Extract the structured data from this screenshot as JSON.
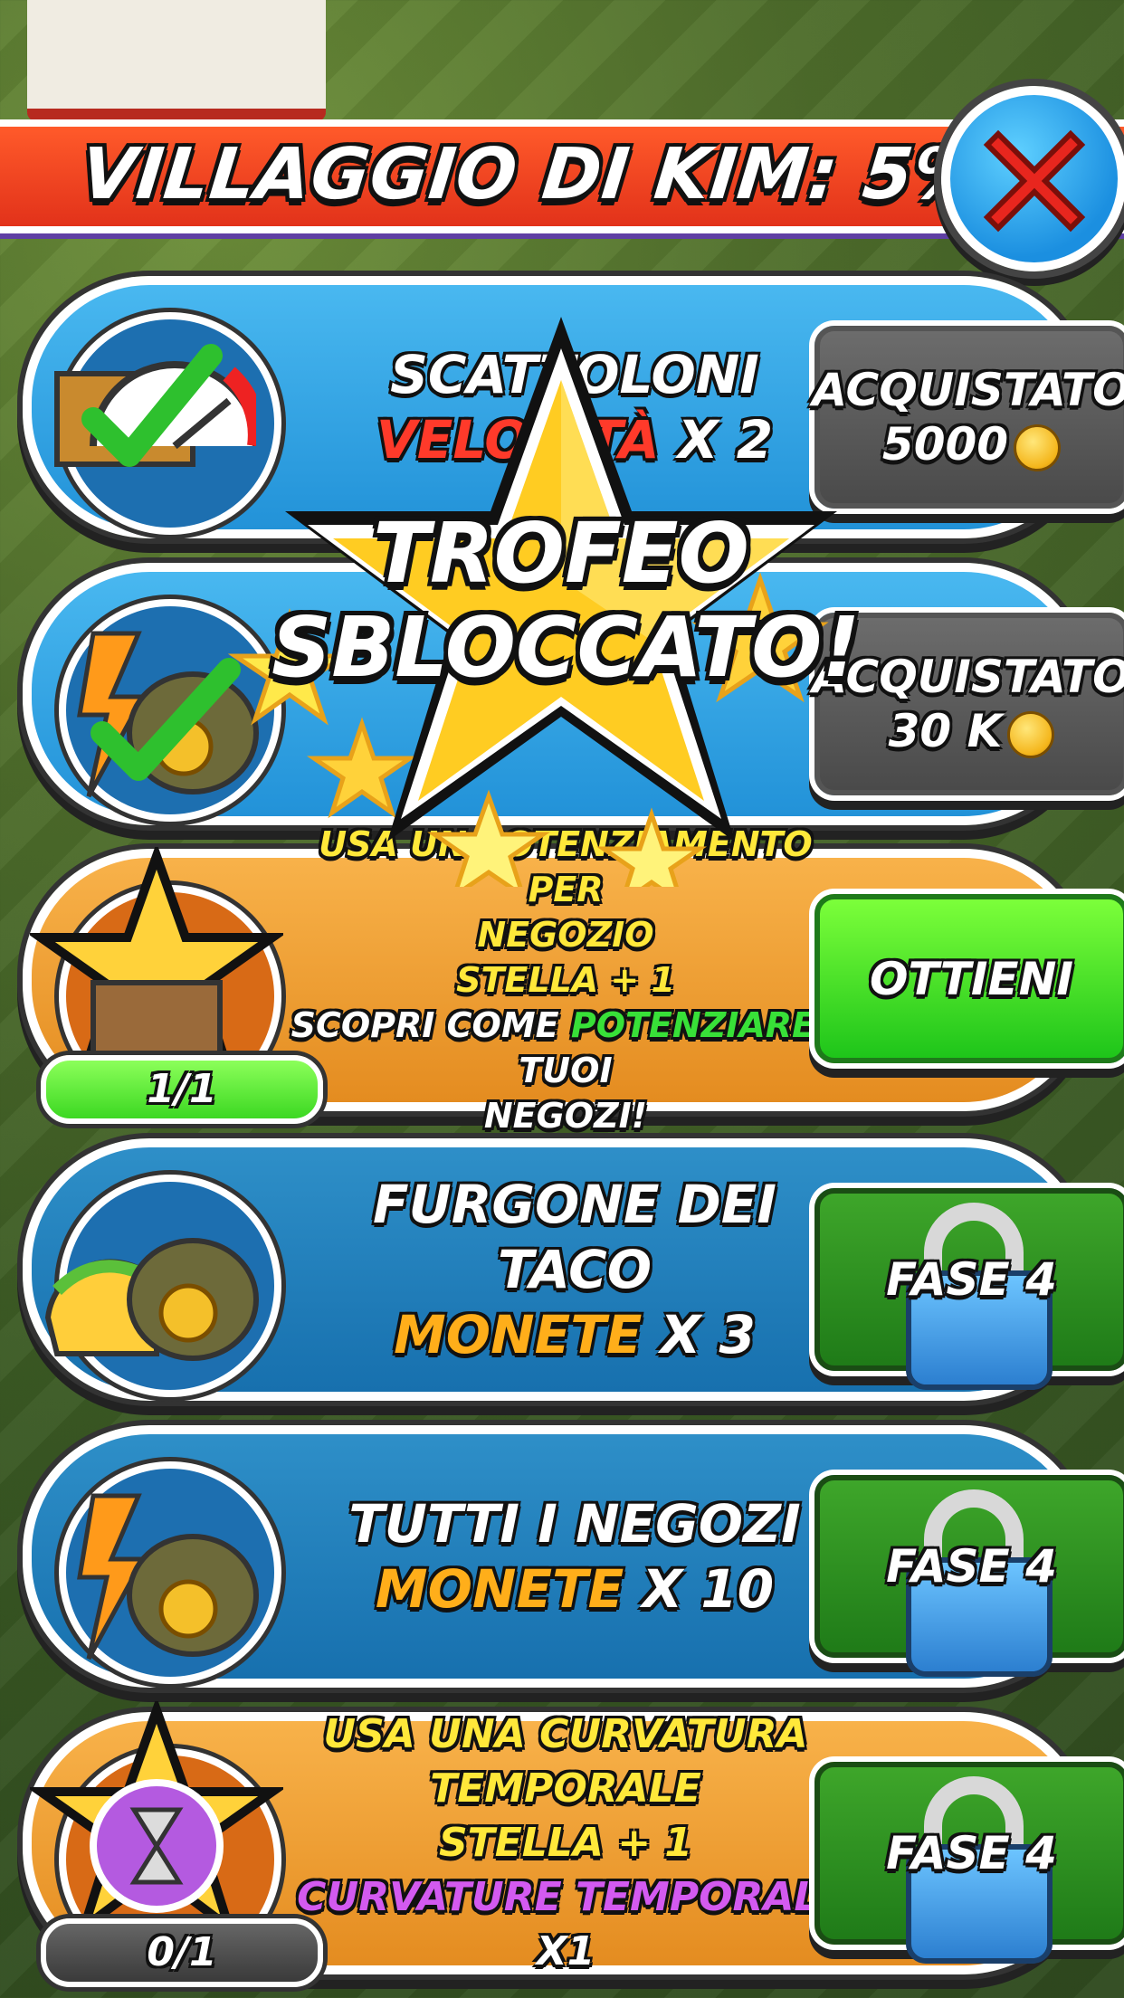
{
  "header": {
    "title": "VILLAGGIO DI KIM: 5%"
  },
  "overlay": {
    "line1": "TROFEO",
    "line2": "SBLOCCATO!"
  },
  "cards": [
    {
      "line1": "SCATTOLONI",
      "line2_colored": "VELOCITÀ",
      "line2_rest": "X 2",
      "button_line1": "ACQUISTATO",
      "button_line2": "5000"
    },
    {
      "button_line1": "ACQUISTATO",
      "button_line2": "30 K"
    },
    {
      "line1": "USA UN POTENZIAMENTO PER",
      "line2": "NEGOZIO",
      "line3": "STELLA + 1",
      "line4_pre": "SCOPRI COME",
      "line4_colored": "POTENZIARE",
      "line4_post": "I TUOI",
      "line5": "NEGOZI!",
      "progress": "1/1",
      "button": "OTTIENI"
    },
    {
      "line1": "FURGONE DEI TACO",
      "line2_colored": "MONETE",
      "line2_rest": "X 3",
      "button": "FASE 4"
    },
    {
      "line1": "TUTTI I NEGOZI",
      "line2_colored": "MONETE",
      "line2_rest": "X 10",
      "button": "FASE 4"
    },
    {
      "line1": "USA UNA CURVATURA",
      "line2": "TEMPORALE",
      "line3": "STELLA + 1",
      "line4_colored": "CURVATURE TEMPORALI",
      "line4_rest": "X1",
      "progress": "0/1",
      "button": "FASE 4"
    }
  ],
  "colors": {
    "title_bar": "#e2321a",
    "blue_card": "#2292d8",
    "orange_card": "#e48c20",
    "green_button": "#1ec51a"
  }
}
